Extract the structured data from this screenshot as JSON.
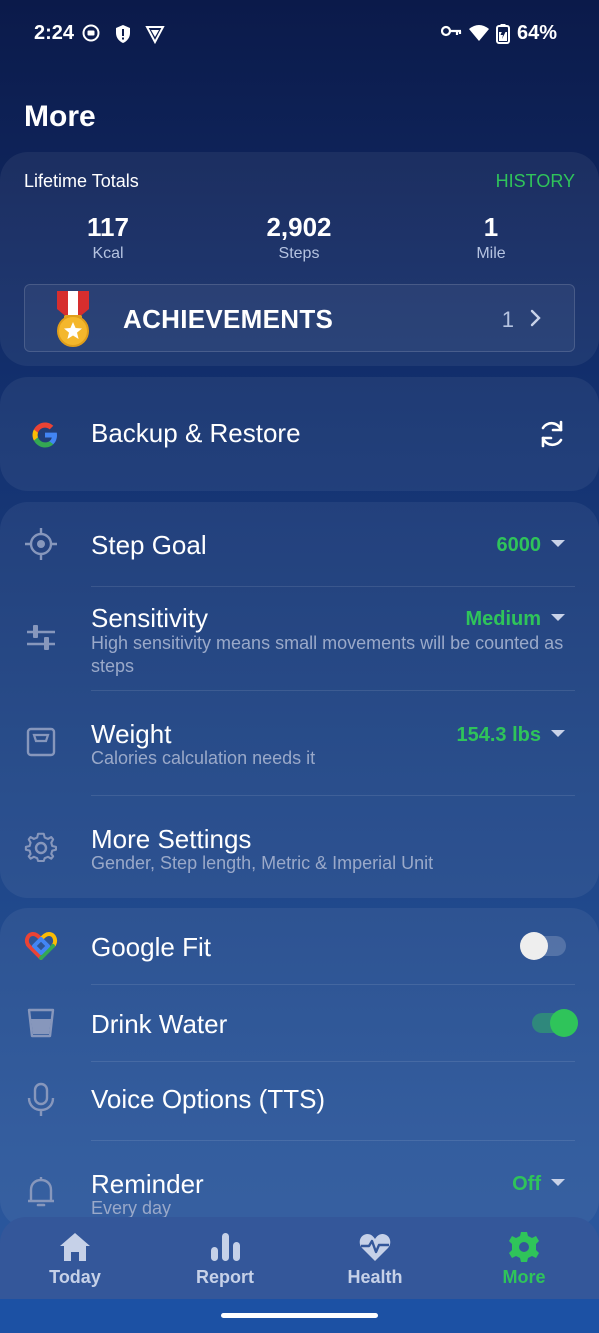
{
  "status_bar": {
    "time": "2:24",
    "battery": "64%"
  },
  "page": {
    "title": "More"
  },
  "totals": {
    "label": "Lifetime Totals",
    "history": "HISTORY",
    "stats": [
      {
        "value": "117",
        "unit": "Kcal"
      },
      {
        "value": "2,902",
        "unit": "Steps"
      },
      {
        "value": "1",
        "unit": "Mile"
      }
    ]
  },
  "achievements": {
    "label": "ACHIEVEMENTS",
    "count": "1"
  },
  "backup": {
    "label": "Backup & Restore"
  },
  "settings": {
    "step_goal": {
      "title": "Step Goal",
      "value": "6000"
    },
    "sensitivity": {
      "title": "Sensitivity",
      "value": "Medium",
      "subtitle": "High sensitivity means small movements will be counted as steps"
    },
    "weight": {
      "title": "Weight",
      "value": "154.3 lbs",
      "subtitle": "Calories calculation needs it"
    },
    "more_settings": {
      "title": "More Settings",
      "subtitle": "Gender, Step length, Metric & Imperial Unit"
    }
  },
  "misc": {
    "google_fit": {
      "title": "Google Fit",
      "enabled": false
    },
    "drink_water": {
      "title": "Drink Water",
      "enabled": true
    },
    "voice": {
      "title": "Voice Options (TTS)"
    },
    "reminder": {
      "title": "Reminder",
      "value": "Off",
      "subtitle": "Every day"
    }
  },
  "nav": {
    "items": [
      {
        "label": "Today",
        "icon": "home-icon"
      },
      {
        "label": "Report",
        "icon": "bar-chart-icon"
      },
      {
        "label": "Health",
        "icon": "heart-pulse-icon"
      },
      {
        "label": "More",
        "icon": "gear-icon"
      }
    ],
    "active": "More"
  },
  "colors": {
    "accent": "#2fc45a",
    "background": "#13306e",
    "muted_text": "#9aa9c9"
  }
}
